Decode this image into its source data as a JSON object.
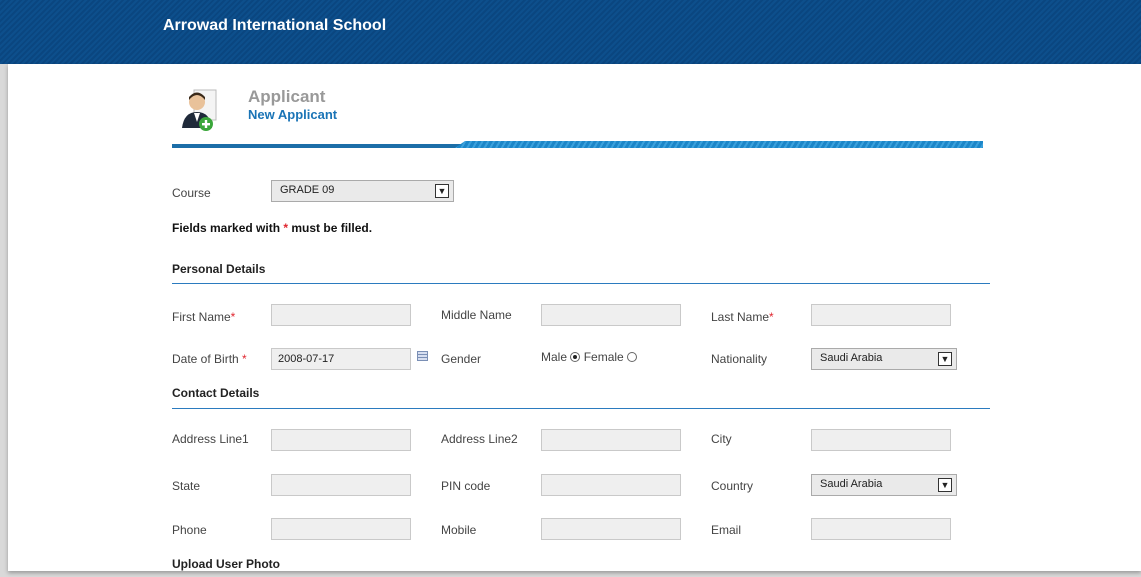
{
  "header": {
    "school_name": "Arrowad International School"
  },
  "page": {
    "title": "Applicant",
    "subtitle": "New Applicant"
  },
  "course": {
    "label": "Course",
    "value": "GRADE 09"
  },
  "note": {
    "prefix": "Fields marked with ",
    "star": "*",
    "suffix": " must be filled."
  },
  "personal": {
    "title": "Personal Details",
    "first_name": {
      "label": "First Name",
      "value": ""
    },
    "middle_name": {
      "label": "Middle Name",
      "value": ""
    },
    "last_name": {
      "label": "Last Name",
      "value": ""
    },
    "dob": {
      "label": "Date of Birth ",
      "value": "2008-07-17"
    },
    "gender": {
      "label": "Gender",
      "male": "Male",
      "female": "Female",
      "selected": "Male"
    },
    "nationality": {
      "label": "Nationality",
      "value": "Saudi Arabia"
    },
    "required_star": "*"
  },
  "contact": {
    "title": "Contact Details",
    "address1": {
      "label": "Address Line1",
      "value": ""
    },
    "address2": {
      "label": "Address Line2",
      "value": ""
    },
    "city": {
      "label": "City",
      "value": ""
    },
    "state": {
      "label": "State",
      "value": ""
    },
    "pin": {
      "label": "PIN code",
      "value": ""
    },
    "country": {
      "label": "Country",
      "value": "Saudi Arabia"
    },
    "phone": {
      "label": "Phone",
      "value": ""
    },
    "mobile": {
      "label": "Mobile",
      "value": ""
    },
    "email": {
      "label": "Email",
      "value": ""
    }
  },
  "upload": {
    "title": "Upload User Photo"
  },
  "icons": {
    "applicant": "user-add-icon",
    "calendar": "calendar-icon",
    "dropdown": "chevron-down-icon"
  },
  "colors": {
    "brand": "#0d4f8c",
    "accent": "#1a74b6",
    "required": "#e0262f"
  }
}
